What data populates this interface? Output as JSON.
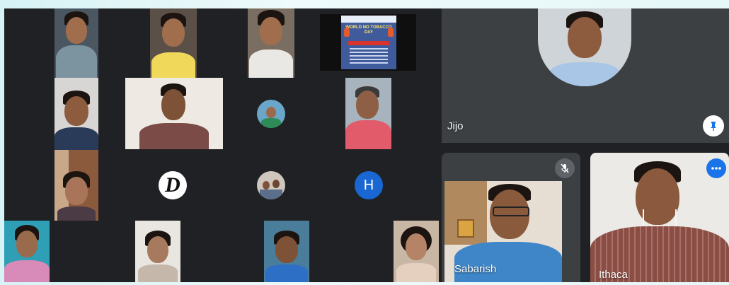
{
  "participants": {
    "jijo": {
      "name": "Jijo"
    },
    "sabarish": {
      "name": "Sabarish"
    },
    "ithaca": {
      "name": "Ithaca"
    }
  },
  "avatars": {
    "d_letter": "D",
    "h_letter": "H"
  },
  "poster": {
    "headline": "WORLD NO TOBACCO DAY"
  },
  "icons": {
    "pin": "pin-icon",
    "mic_off": "mic-off-icon",
    "more": "more-options-icon"
  },
  "colors": {
    "meet_bg": "#202124",
    "tile_bg": "#3c4043",
    "accent_blue": "#1a73e8",
    "h_avatar": "#1967d2"
  }
}
